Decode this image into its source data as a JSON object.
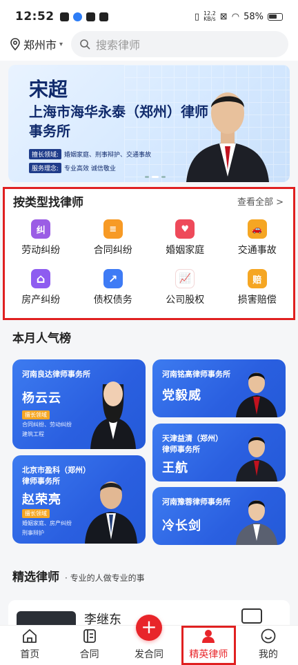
{
  "status": {
    "time": "12:52",
    "net_top": "12.2",
    "net_bottom": "KB/s",
    "battery": "58%"
  },
  "header": {
    "city": "郑州市",
    "search_placeholder": "搜索律师"
  },
  "banner": {
    "name": "宋超",
    "firm": "上海市海华永泰（郑州）律师事务所",
    "field_tag": "擅长领域:",
    "field_value": "婚姻家庭、刑事辩护、交通事故",
    "concept_tag": "服务理念:",
    "concept_value": "专业高效 诚信敬业"
  },
  "types": {
    "title": "按类型找律师",
    "view_all": "查看全部 >",
    "items": [
      {
        "label": "劳动纠纷",
        "icon": "labor-icon",
        "color": "#9b5de5",
        "glyph": "纠"
      },
      {
        "label": "合同纠纷",
        "icon": "contract-icon",
        "color": "#f79a25",
        "glyph": "≡"
      },
      {
        "label": "婚姻家庭",
        "icon": "marriage-icon",
        "color": "#ee4a5a",
        "glyph": "♥"
      },
      {
        "label": "交通事故",
        "icon": "traffic-icon",
        "color": "#f5a623",
        "glyph": "🚗"
      },
      {
        "label": "房产纠纷",
        "icon": "house-icon",
        "color": "#8e5cf0",
        "glyph": "⌂"
      },
      {
        "label": "债权债务",
        "icon": "debt-icon",
        "color": "#3e7bf5",
        "glyph": "↗"
      },
      {
        "label": "公司股权",
        "icon": "equity-icon",
        "color": "#ef3b3b",
        "glyph": "📈"
      },
      {
        "label": "损害赔偿",
        "icon": "compensation-icon",
        "color": "#f5a623",
        "glyph": "赔"
      }
    ]
  },
  "popular": {
    "title": "本月人气榜",
    "cards": [
      {
        "firm": "河南良达律师事务所",
        "name": "杨云云",
        "badge": "擅长领域",
        "areas1": "合同纠纷、劳动纠纷",
        "areas2": "建筑工程"
      },
      {
        "firm": "河南铭高律师事务所",
        "name": "党毅威"
      },
      {
        "firm": "天津益清（郑州）",
        "firm2": "律师事务所",
        "name": "王航"
      },
      {
        "firm": "北京市盈科（郑州）",
        "firm2": "律师事务所",
        "name": "赵荣亮",
        "badge": "擅长领域",
        "areas1": "婚姻家庭、房产纠纷",
        "areas2": "刑事辩护"
      },
      {
        "firm": "河南豫蓉律师事务所",
        "name": "冷长剑"
      }
    ]
  },
  "selected": {
    "title": "精选律师",
    "subtitle": "· 专业的人做专业的事",
    "first_name": "李继东"
  },
  "tabbar": {
    "items": [
      "首页",
      "合同",
      "发合同",
      "精英律师",
      "我的"
    ],
    "active": "精英律师",
    "accent": "#e8252a"
  }
}
